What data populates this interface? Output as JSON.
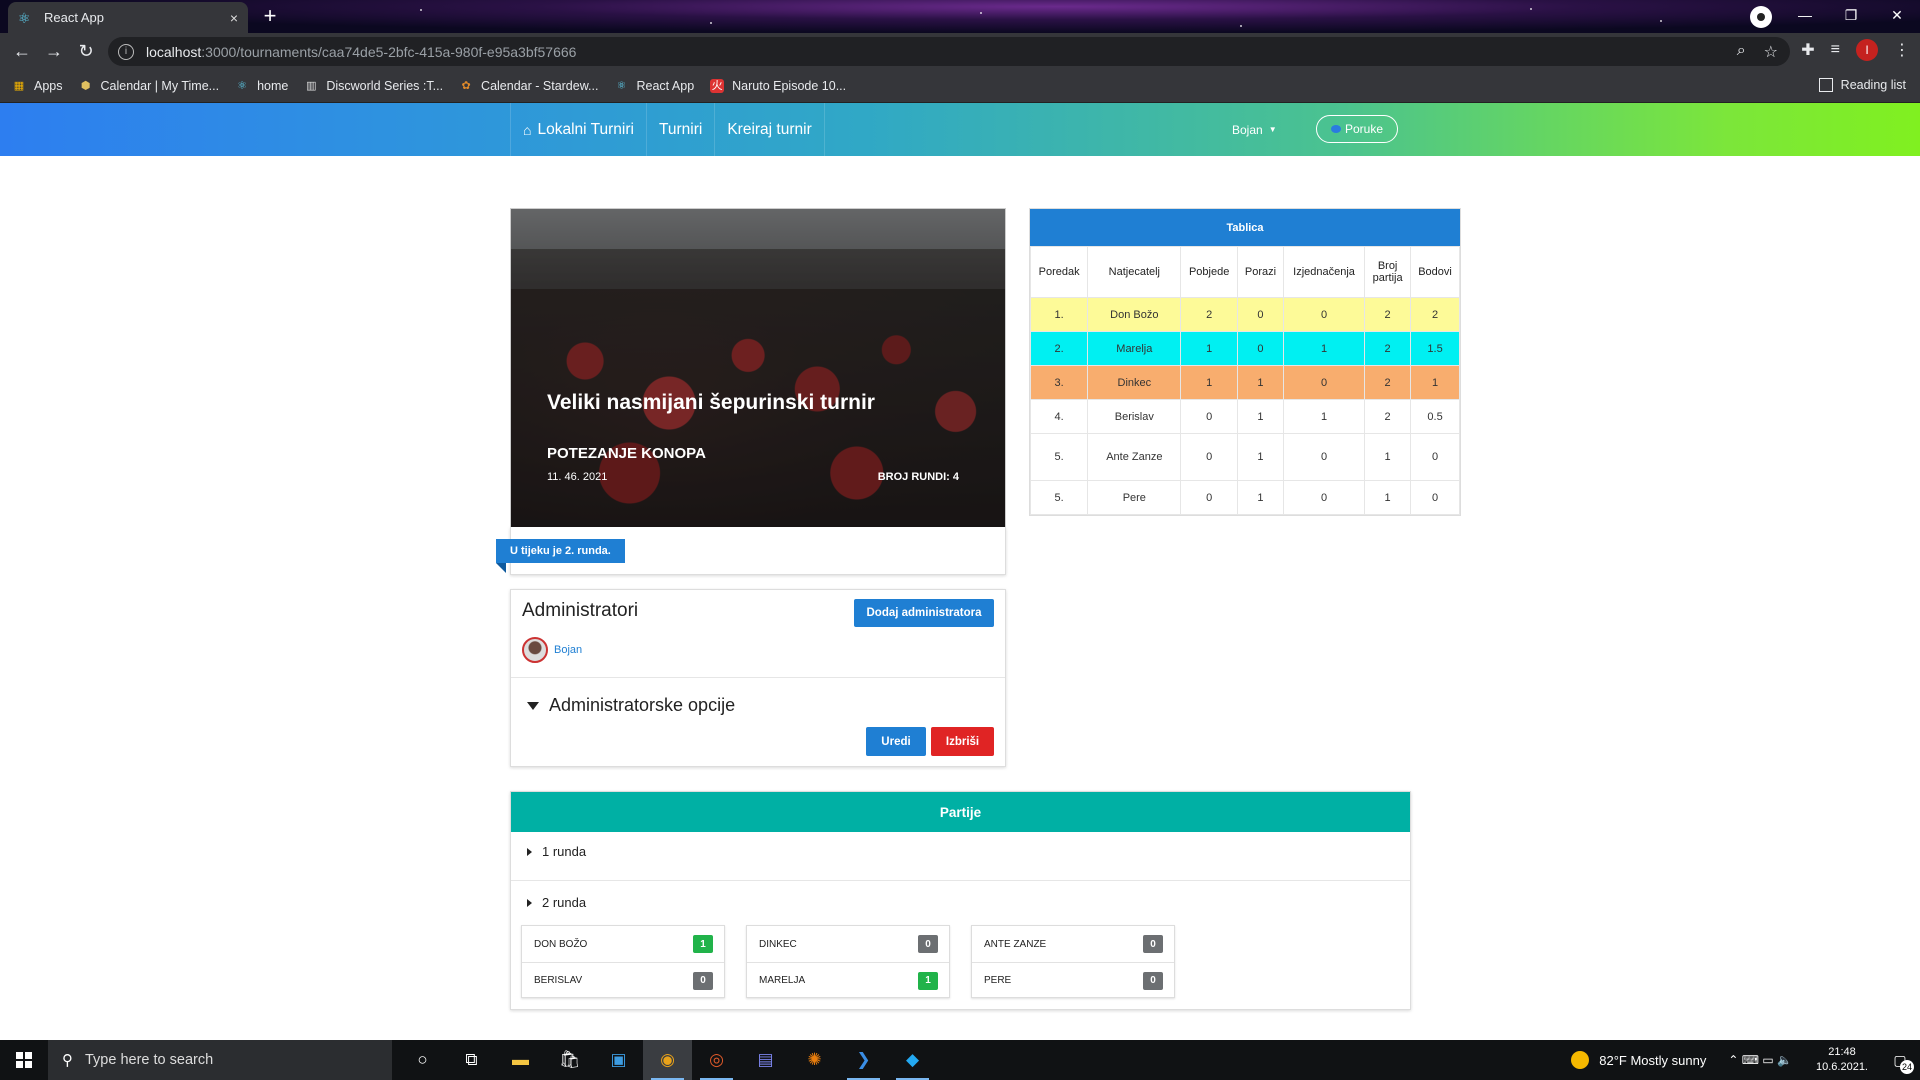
{
  "browser": {
    "tab_title": "React App",
    "tab_close": "×",
    "new_tab": "+",
    "url_host": "localhost",
    "url_rest": ":3000/tournaments/caa74de5-2bfc-415a-980f-e95a3bf57666",
    "profile_initial": "I",
    "bookmarks": [
      {
        "label": "Apps"
      },
      {
        "label": "Calendar | My Time..."
      },
      {
        "label": "home"
      },
      {
        "label": "Discworld Series :T..."
      },
      {
        "label": "Calendar - Stardew..."
      },
      {
        "label": "React App"
      },
      {
        "label": "Naruto Episode 10..."
      }
    ],
    "reading_list": "Reading list"
  },
  "navbar": {
    "links": [
      "Lokalni Turniri",
      "Turniri",
      "Kreiraj turnir"
    ],
    "user": "Bojan",
    "messages": "Poruke"
  },
  "tournament": {
    "title": "Veliki nasmijani šepurinski turnir",
    "sport": "POTEZANJE KONOPA",
    "date": "11. 46. 2021",
    "rounds": "BROJ RUNDI: 4",
    "status": "U tijeku je 2. runda."
  },
  "admins": {
    "heading": "Administratori",
    "add_button": "Dodaj administratora",
    "users": [
      "Bojan"
    ],
    "options_heading": "Administratorske opcije",
    "edit_button": "Uredi",
    "delete_button": "Izbriši"
  },
  "standings": {
    "title": "Tablica",
    "columns": [
      "Poredak",
      "Natjecatelj",
      "Pobjede",
      "Porazi",
      "Izjednačenja",
      "Broj partija",
      "Bodovi"
    ],
    "rows": [
      {
        "rank": "1.",
        "name": "Don Božo",
        "wins": "2",
        "losses": "0",
        "draws": "0",
        "games": "2",
        "points": "2",
        "highlight": "#fdfa98"
      },
      {
        "rank": "2.",
        "name": "Marelja",
        "wins": "1",
        "losses": "0",
        "draws": "1",
        "games": "2",
        "points": "1.5",
        "highlight": "#00f0f2"
      },
      {
        "rank": "3.",
        "name": "Dinkec",
        "wins": "1",
        "losses": "1",
        "draws": "0",
        "games": "2",
        "points": "1",
        "highlight": "#f8ad6e"
      },
      {
        "rank": "4.",
        "name": "Berislav",
        "wins": "0",
        "losses": "1",
        "draws": "1",
        "games": "2",
        "points": "0.5"
      },
      {
        "rank": "5.",
        "name": "Ante Zanze",
        "wins": "0",
        "losses": "1",
        "draws": "0",
        "games": "1",
        "points": "0"
      },
      {
        "rank": "5.",
        "name": "Pere",
        "wins": "0",
        "losses": "1",
        "draws": "0",
        "games": "1",
        "points": "0"
      }
    ]
  },
  "games": {
    "title": "Partije",
    "rounds": [
      "1 runda",
      "2 runda"
    ],
    "matches": [
      {
        "p1": "DON BOŽO",
        "s1": "1",
        "p2": "BERISLAV",
        "s2": "0"
      },
      {
        "p1": "DINKEC",
        "s1": "0",
        "p2": "MARELJA",
        "s2": "1"
      },
      {
        "p1": "ANTE ZANZE",
        "s1": "0",
        "p2": "PERE",
        "s2": "0"
      }
    ]
  },
  "taskbar": {
    "search_placeholder": "Type here to search",
    "weather": "82°F  Mostly sunny",
    "time": "21:48",
    "date": "10.6.2021.",
    "notifications": "24"
  },
  "colors": {
    "accent_blue": "#1f7fd3",
    "teal": "#00b0a4",
    "danger": "#e02424",
    "win": "#21b34a",
    "neutral_score": "#6c6f72"
  }
}
